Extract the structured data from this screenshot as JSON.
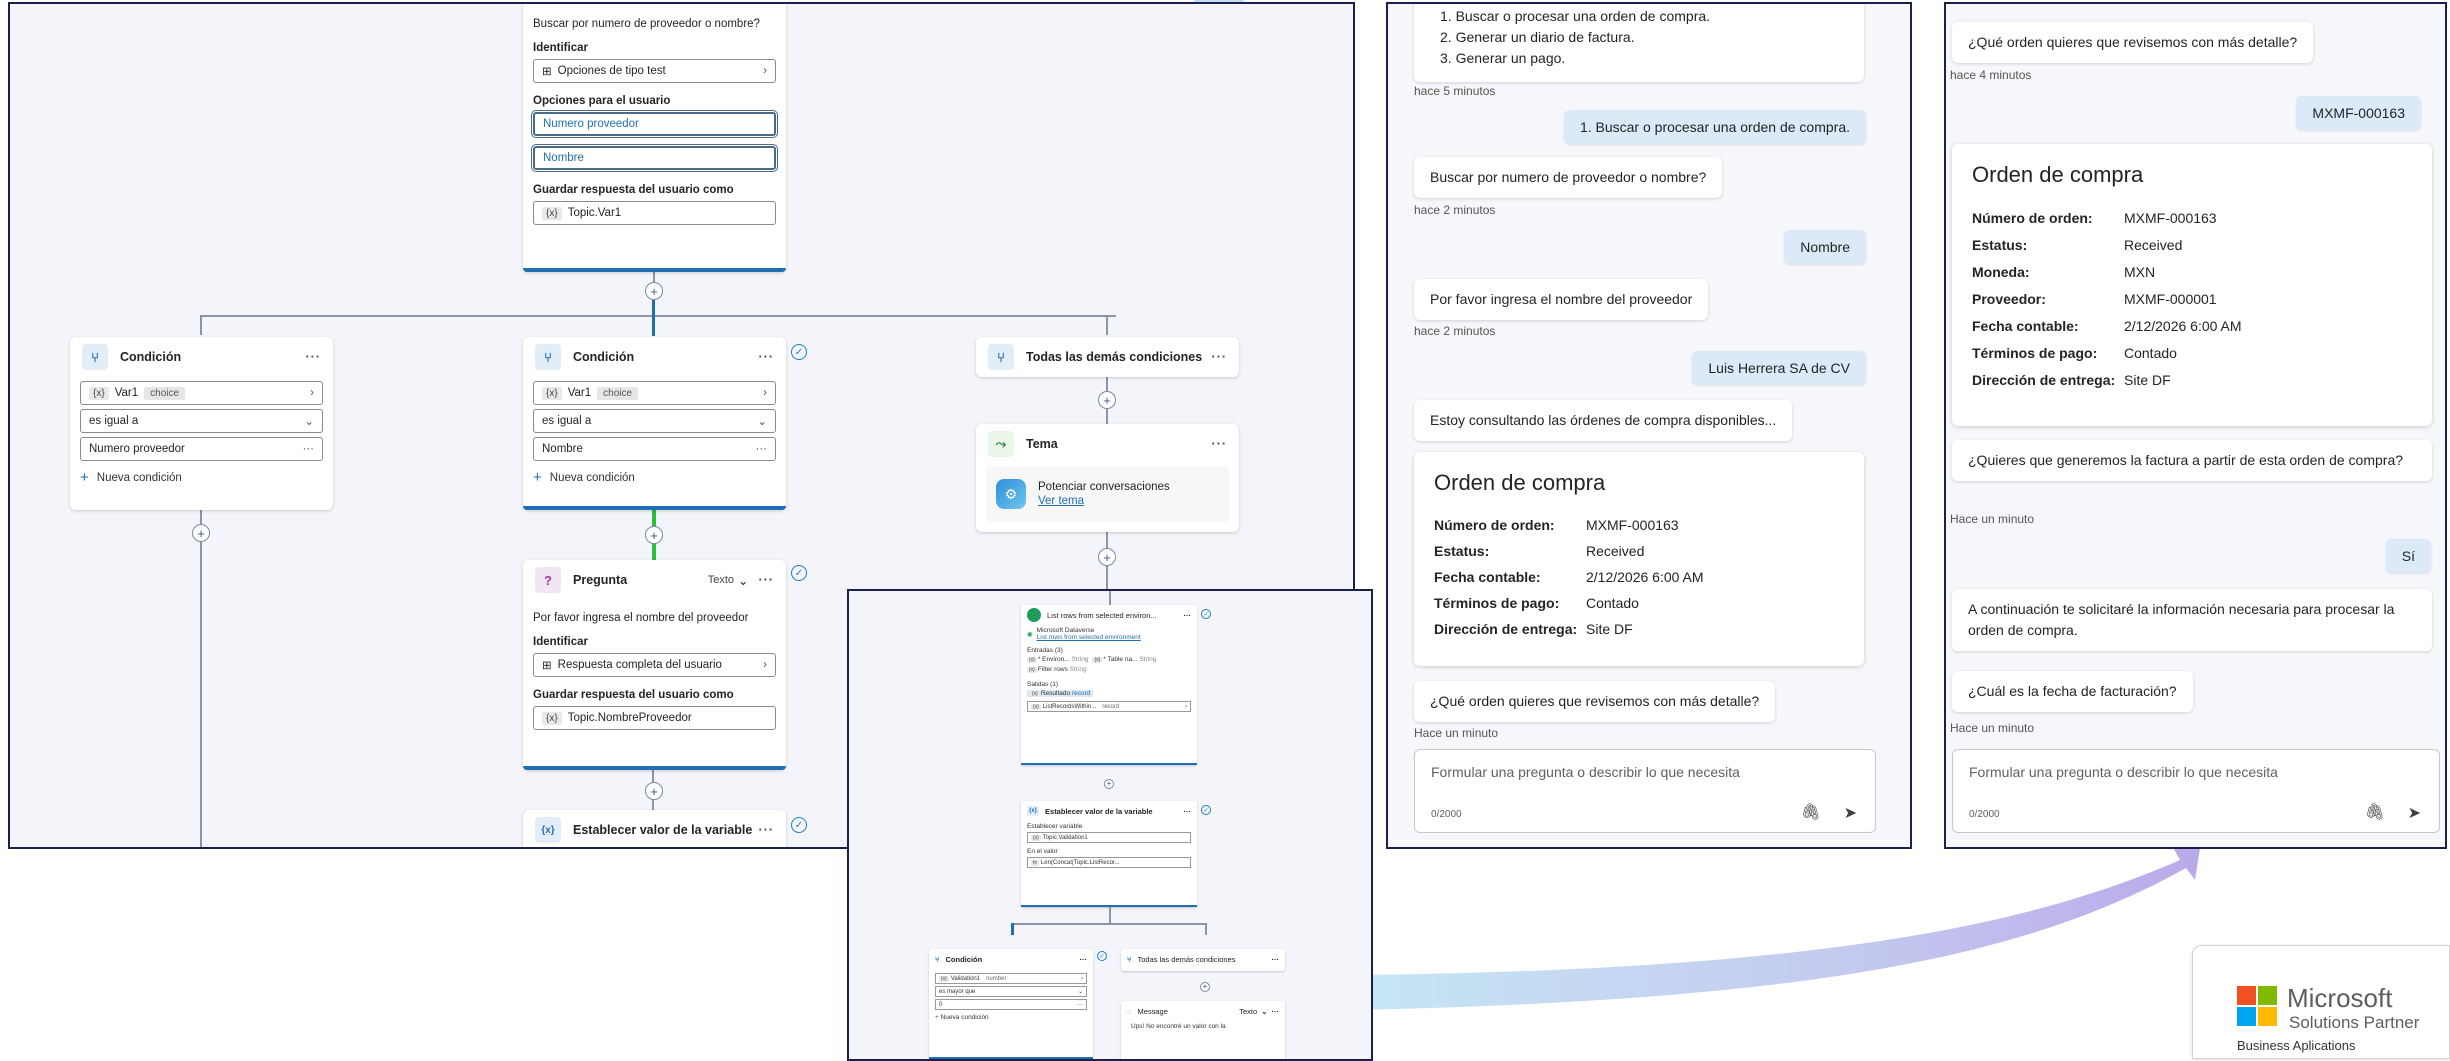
{
  "flow_top_question": {
    "prompt": "Buscar por numero de proveedor o nombre?",
    "identify_label": "Identificar",
    "identify_value": "Opciones de tipo test",
    "options_label": "Opciones para el usuario",
    "options": [
      "Numero proveedor",
      "Nombre"
    ],
    "save_label": "Guardar respuesta del usuario como",
    "save_value": "Topic.Var1",
    "var_token": "{x}"
  },
  "cond_left": {
    "title": "Condición",
    "var": "Var1",
    "type": "choice",
    "operator": "es igual a",
    "value": "Numero proveedor",
    "new_condition": "Nueva condición"
  },
  "cond_mid": {
    "title": "Condición",
    "var": "Var1",
    "type": "choice",
    "operator": "es igual a",
    "value": "Nombre",
    "new_condition": "Nueva condición"
  },
  "cond_right": {
    "title": "Todas las demás condiciones"
  },
  "tema": {
    "title": "Tema",
    "item": "Potenciar conversaciones",
    "link": "Ver tema"
  },
  "pregunta": {
    "title": "Pregunta",
    "type": "Texto",
    "prompt": "Por favor ingresa el nombre del proveedor",
    "identify_label": "Identificar",
    "identify_value": "Respuesta completa del usuario",
    "save_label": "Guardar respuesta del usuario como",
    "save_value": "Topic.NombreProveedor"
  },
  "set_var": {
    "title": "Establecer valor de la variable"
  },
  "mini": {
    "list_rows": "List rows from selected environ...",
    "dataverse": "Microsoft Dataverse",
    "dataverse_link": "List rows from selected environment",
    "inputs": "Entradas (3)",
    "in1": "* Environ...",
    "in1_type": "String",
    "in2": "* Table na...",
    "in2_type": "String",
    "in3": "Filter rows",
    "in3_type": "String",
    "outputs": "Salidas (1)",
    "out1": "Resultado",
    "out1_type": "record",
    "out2": "ListRecordsWithin...",
    "out2_type": "record",
    "setvar_title": "Establecer valor de la variable",
    "setvar_label": "Establecer variable",
    "setvar_var": "Topic.Validation1",
    "setvar_val_label": "En el valor",
    "setvar_val": "Len(Concat(Topic.ListRecor...",
    "cond_title": "Condición",
    "cond_var": "Validation1",
    "cond_type": "number",
    "cond_op": "es mayor que",
    "cond_val": "0",
    "cond_new": "Nueva condición",
    "other_title": "Todas las demás condiciones",
    "msg_title": "Message",
    "msg_type": "Texto",
    "msg_text": "Ups! No encontré un valor con la"
  },
  "chat1": {
    "list_items": [
      "1. Buscar o procesar una orden de compra.",
      "2. Generar un diario de factura.",
      "3. Generar un pago."
    ],
    "ts1": "hace 5 minutos",
    "user1": "1. Buscar o procesar una orden de compra.",
    "bot2": "Buscar por numero de proveedor o nombre?",
    "ts2": "hace 2 minutos",
    "user2": "Nombre",
    "bot3": "Por favor ingresa el nombre del proveedor",
    "ts3": "hace 2 minutos",
    "user3": "Luis Herrera SA de CV",
    "bot4": "Estoy consultando las órdenes de compra disponibles...",
    "card_title": "Orden de compra",
    "card_rows": [
      {
        "k": "Número de orden:",
        "v": "MXMF-000163"
      },
      {
        "k": "Estatus:",
        "v": "Received"
      },
      {
        "k": "Fecha contable:",
        "v": "2/12/2026 6:00 AM"
      },
      {
        "k": "Términos de pago:",
        "v": "Contado"
      },
      {
        "k": "Dirección de entrega:",
        "v": "Site DF"
      }
    ],
    "bot5": "¿Qué orden quieres que revisemos con más detalle?",
    "ts4": "Hace un minuto",
    "placeholder": "Formular una pregunta o describir lo que necesita",
    "counter": "0/2000"
  },
  "chat2": {
    "bot1": "¿Qué orden quieres que revisemos con más detalle?",
    "ts1": "hace 4 minutos",
    "user1": "MXMF-000163",
    "card_title": "Orden de compra",
    "card_rows": [
      {
        "k": "Número de orden:",
        "v": "MXMF-000163"
      },
      {
        "k": "Estatus:",
        "v": "Received"
      },
      {
        "k": "Moneda:",
        "v": "MXN"
      },
      {
        "k": "Proveedor:",
        "v": "MXMF-000001"
      },
      {
        "k": "Fecha contable:",
        "v": "2/12/2026 6:00 AM"
      },
      {
        "k": "Términos de pago:",
        "v": "Contado"
      },
      {
        "k": "Dirección de entrega:",
        "v": "Site DF"
      }
    ],
    "bot2": "¿Quieres que generemos la factura a partir de esta orden de compra?",
    "ts2": "Hace un minuto",
    "user2": "Sí",
    "bot3": "A continuación te solicitaré la información necesaria para procesar la orden de compra.",
    "bot4": "¿Cuál es la fecha de facturación?",
    "ts3": "Hace un minuto",
    "placeholder": "Formular una pregunta o describir lo que necesita",
    "counter": "0/2000"
  },
  "badge": {
    "brand": "Microsoft",
    "line1": "Solutions Partner",
    "line2": "Business Aplications"
  },
  "colors": {
    "accent_blue": "#1f6fb2",
    "user_bubble": "#dbe9f8",
    "arrow_start": "#bfe3f4",
    "arrow_end": "#c3b5ec",
    "green_bar": "#2fbf3f"
  }
}
